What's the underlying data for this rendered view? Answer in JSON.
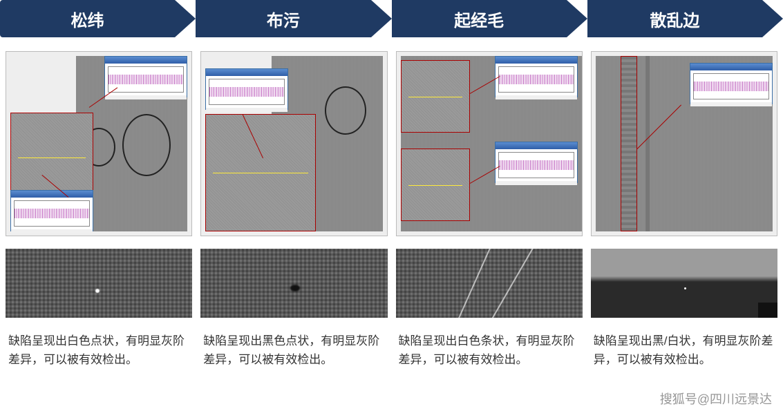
{
  "headers": [
    {
      "label": "松纬"
    },
    {
      "label": "布污"
    },
    {
      "label": "起经毛"
    },
    {
      "label": "散乱边"
    }
  ],
  "columns": [
    {
      "description": "缺陷呈现出白色点状，有明显灰阶差异，可以被有效检出。"
    },
    {
      "description": "缺陷呈现出黑色点状，有明显灰阶差异，可以被有效检出。"
    },
    {
      "description": "缺陷呈现出白色条状，有明显灰阶差异，可以被有效检出。"
    },
    {
      "description": "缺陷呈现出黑/白状，有明显灰阶差异，可以被有效检出。"
    }
  ],
  "watermark": "搜狐号@四川远景达"
}
